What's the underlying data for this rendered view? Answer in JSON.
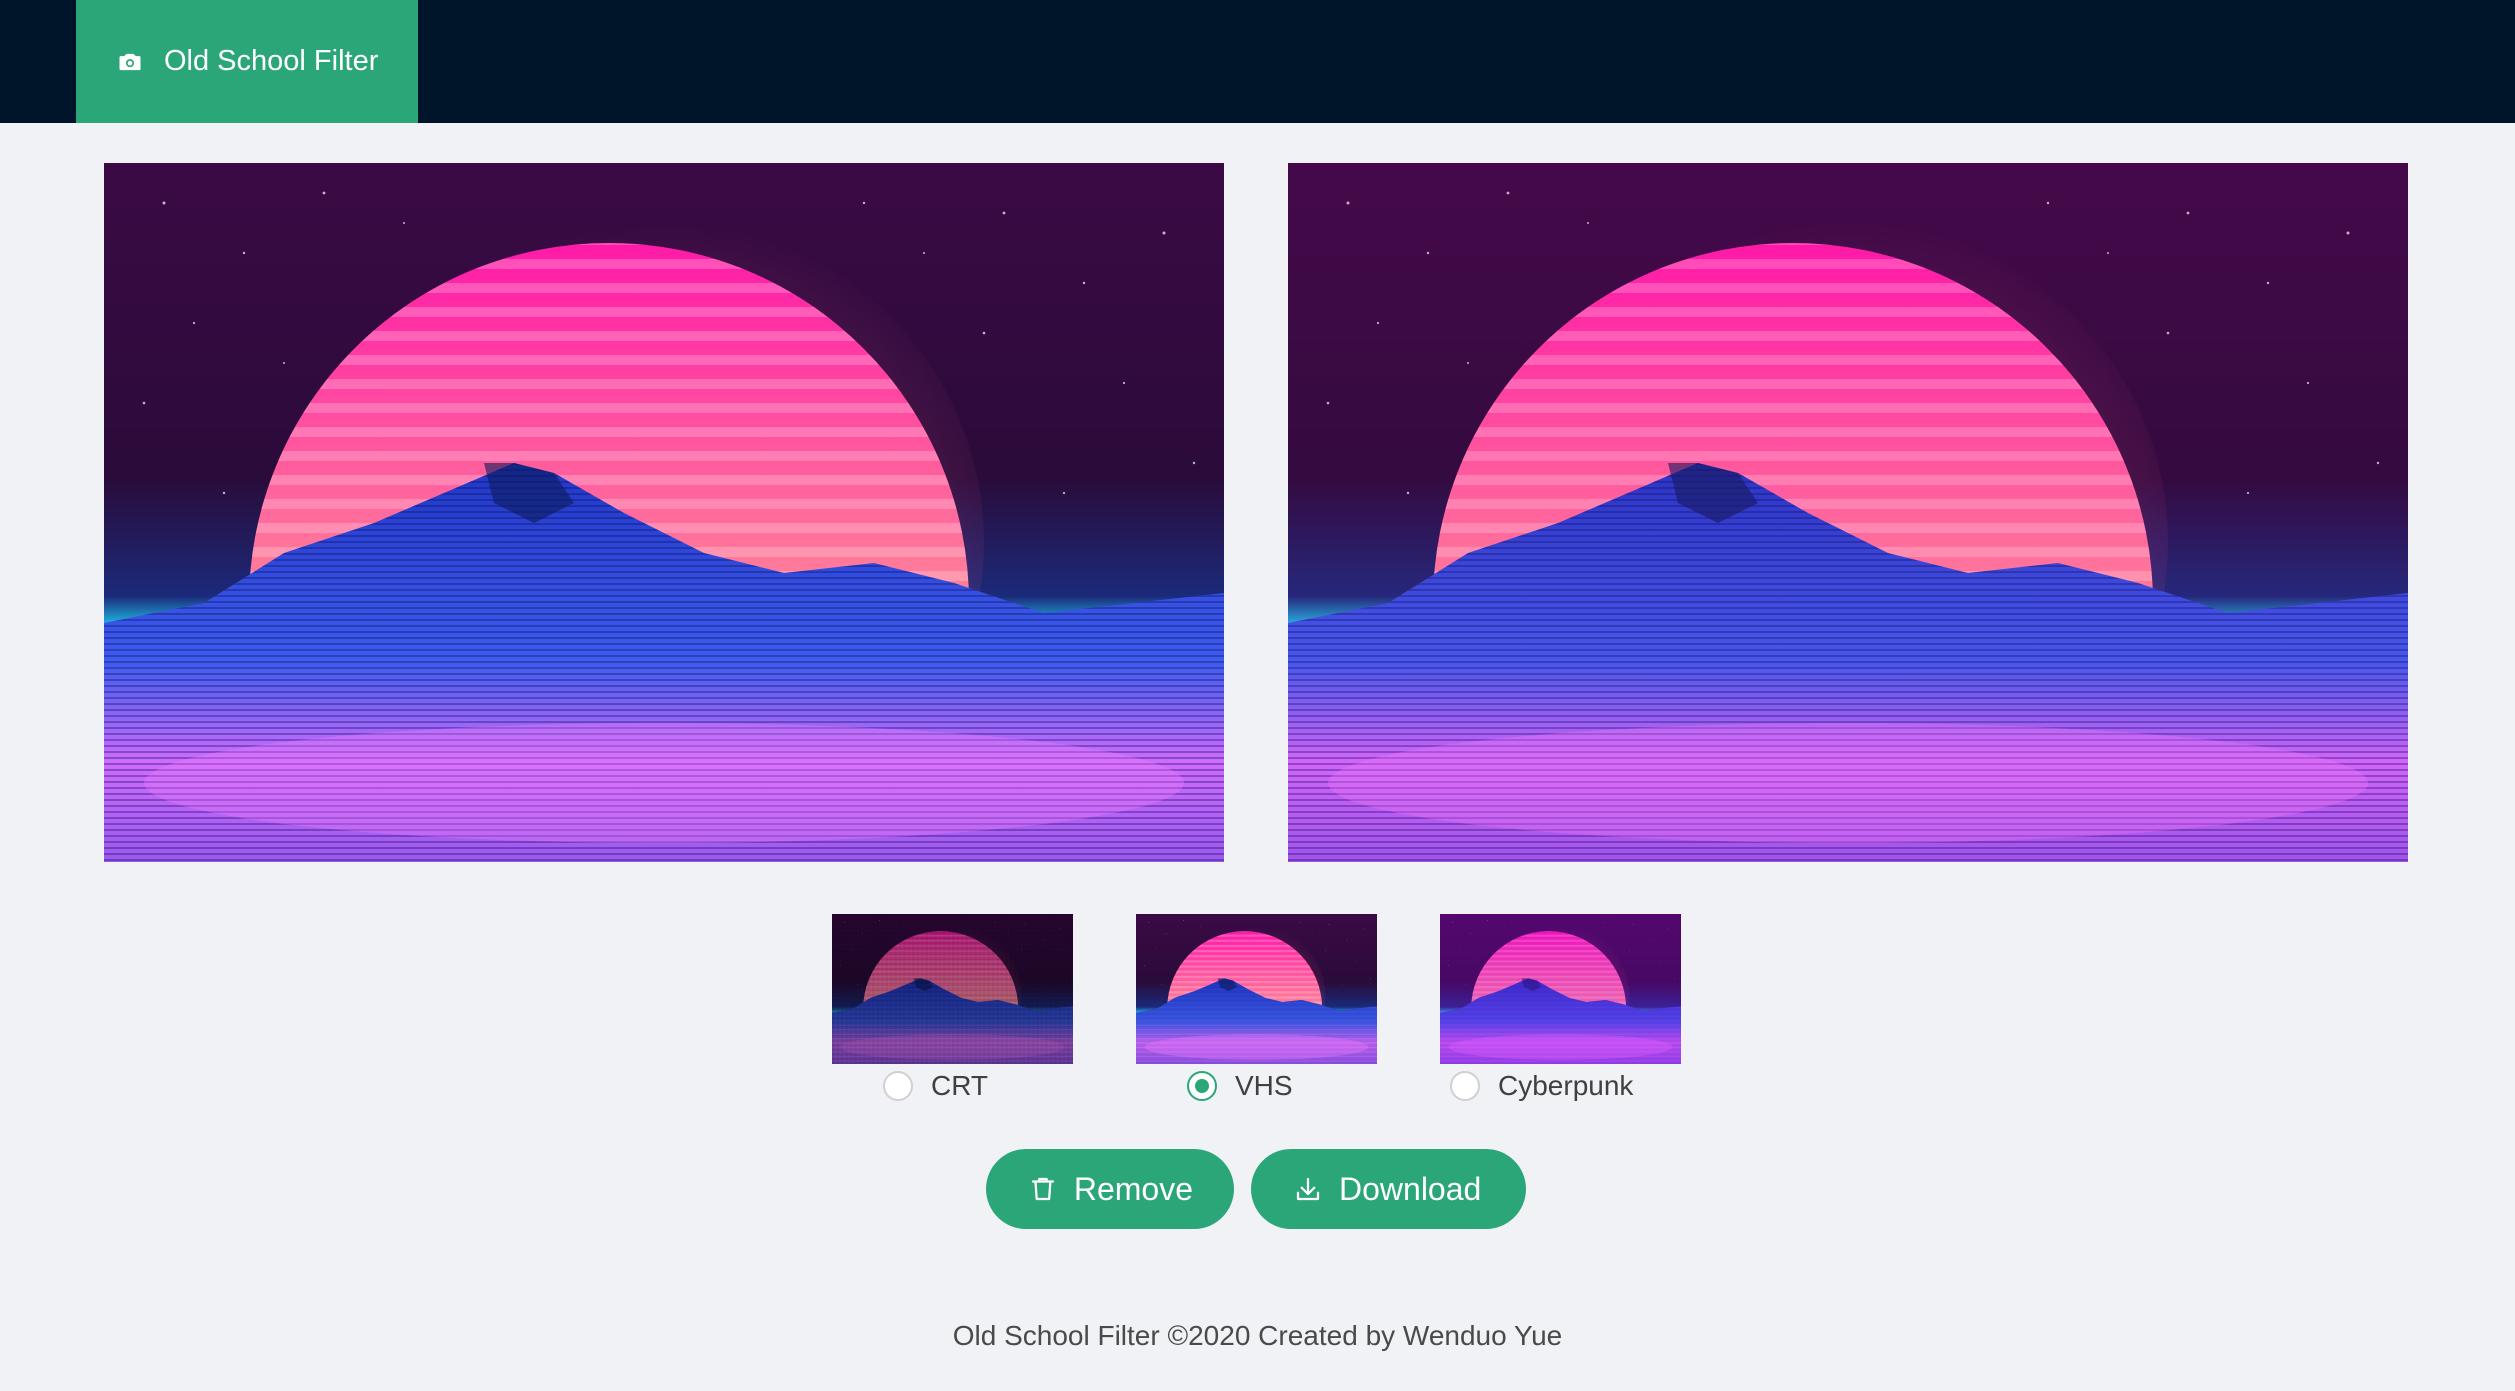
{
  "header": {
    "brand_label": "Old School Filter",
    "brand_icon": "camera-icon",
    "colors": {
      "background": "#001529",
      "brand": "#2ba678"
    }
  },
  "filters": {
    "selected": "VHS",
    "options": [
      {
        "label": "CRT",
        "checked": false
      },
      {
        "label": "VHS",
        "checked": true
      },
      {
        "label": "Cyberpunk",
        "checked": false
      }
    ]
  },
  "actions": {
    "remove_label": "Remove",
    "remove_icon": "trash-icon",
    "download_label": "Download",
    "download_icon": "download-icon"
  },
  "footer": {
    "text": "Old School Filter ©2020 Created by Wenduo Yue"
  }
}
